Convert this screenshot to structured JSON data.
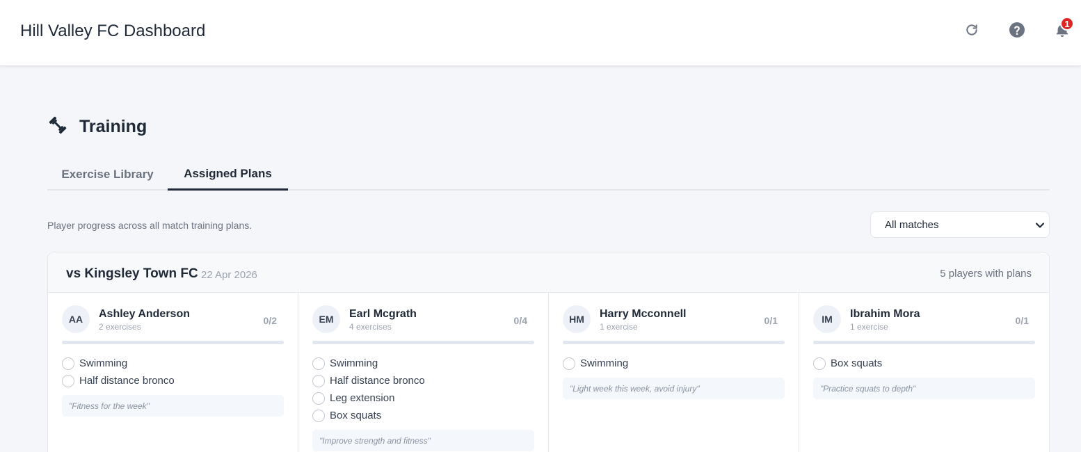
{
  "app": {
    "title": "Hill Valley FC Dashboard",
    "notification_count": "1",
    "icons": [
      "refresh-icon",
      "help-icon",
      "bell-icon"
    ]
  },
  "section": {
    "title": "Training",
    "icon": "dumbbell-icon"
  },
  "tabs": [
    {
      "label": "Exercise Library",
      "active": false
    },
    {
      "label": "Assigned Plans",
      "active": true
    }
  ],
  "subtitle": "Player progress across all match training plans.",
  "filter": {
    "selected": "All matches"
  },
  "match": {
    "title": "vs Kingsley Town FC",
    "date": "22 Apr 2026",
    "players_summary": "5 players with plans",
    "players": [
      {
        "initials": "AA",
        "name": "Ashley Anderson",
        "exercise_count": "2 exercises",
        "progress": "0/2",
        "progress_fraction": 0,
        "exercises": [
          "Swimming",
          "Half distance bronco"
        ],
        "note": "\"Fitness for the week\""
      },
      {
        "initials": "EM",
        "name": "Earl Mcgrath",
        "exercise_count": "4 exercises",
        "progress": "0/4",
        "progress_fraction": 0,
        "exercises": [
          "Swimming",
          "Half distance bronco",
          "Leg extension",
          "Box squats"
        ],
        "note": "\"Improve strength and fitness\""
      },
      {
        "initials": "HM",
        "name": "Harry Mcconnell",
        "exercise_count": "1 exercise",
        "progress": "0/1",
        "progress_fraction": 0,
        "exercises": [
          "Swimming"
        ],
        "note": "\"Light week this week, avoid injury\""
      },
      {
        "initials": "IM",
        "name": "Ibrahim Mora",
        "exercise_count": "1 exercise",
        "progress": "0/1",
        "progress_fraction": 0,
        "exercises": [
          "Box squats"
        ],
        "note": "\"Practice squats to depth\""
      }
    ]
  },
  "colors": {
    "accent": "#1f2937",
    "badge": "#dc2626",
    "background": "#f4f6f9"
  }
}
